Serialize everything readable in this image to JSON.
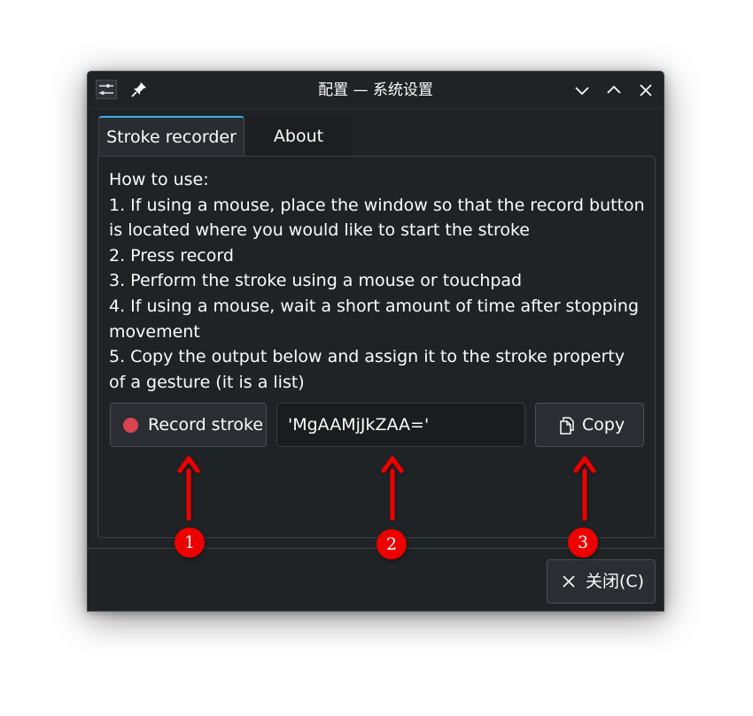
{
  "window": {
    "title": "配置 — 系统设置"
  },
  "tabs": [
    {
      "label": "Stroke recorder",
      "active": true
    },
    {
      "label": "About",
      "active": false
    }
  ],
  "instructions": {
    "lines": [
      "How to use:",
      "1. If using a mouse, place the window so that the record button",
      "is located where you would like to start the stroke",
      "2. Press record",
      "3. Perform the stroke using a mouse or touchpad",
      "4. If using a mouse, wait a short amount of time after stopping",
      "movement",
      "5. Copy the output below and assign it to the stroke property",
      "of a gesture (it is a list)"
    ]
  },
  "controls": {
    "record_label": "Record stroke",
    "output_value": "'MgAAMjJkZAA='",
    "copy_label": "Copy"
  },
  "footer": {
    "close_label": "关闭(C)"
  },
  "annotations": [
    {
      "number": "1"
    },
    {
      "number": "2"
    },
    {
      "number": "3"
    }
  ],
  "colors": {
    "window_bg": "#202326",
    "accent": "#3daee9",
    "record_dot": "#da4453",
    "annotation_red": "#ee0000"
  }
}
